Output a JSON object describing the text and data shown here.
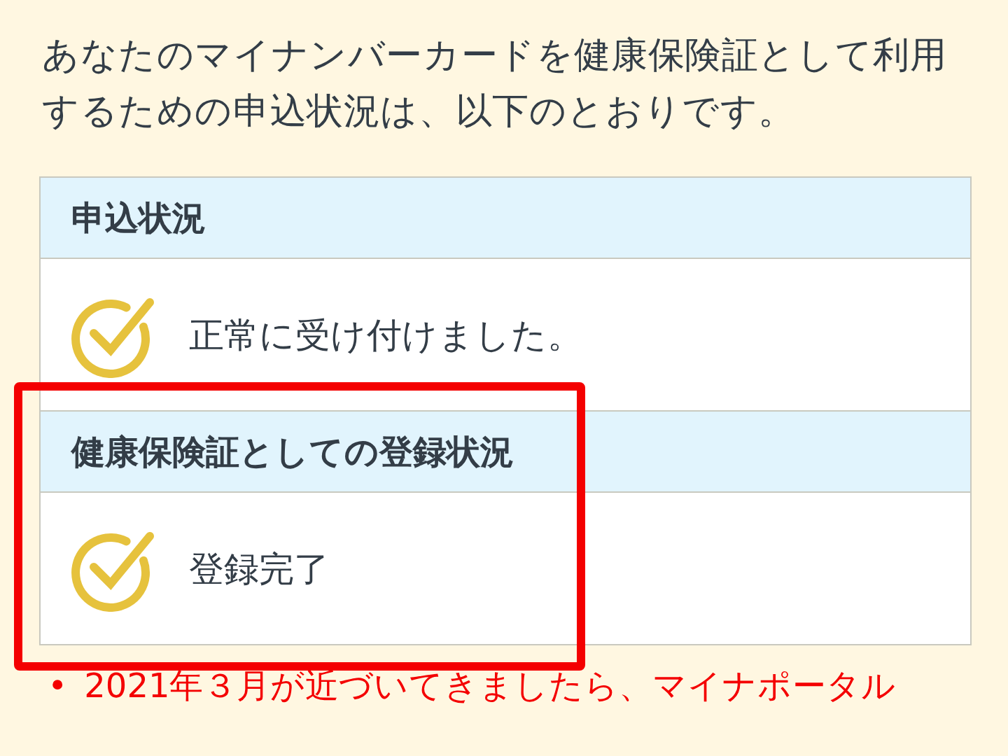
{
  "intro": "あなたのマイナンバーカードを健康保険証として利用するための申込状況は、以下のとおりです。",
  "sections": [
    {
      "heading": "申込状況",
      "status": "正常に受け付けました。",
      "highlighted": false
    },
    {
      "heading": "健康保険証としての登録状況",
      "status": "登録完了",
      "highlighted": true
    }
  ],
  "notes": [
    {
      "marker": "•",
      "text": "2021年３月が近づいてきましたら、マイナポータル"
    }
  ]
}
